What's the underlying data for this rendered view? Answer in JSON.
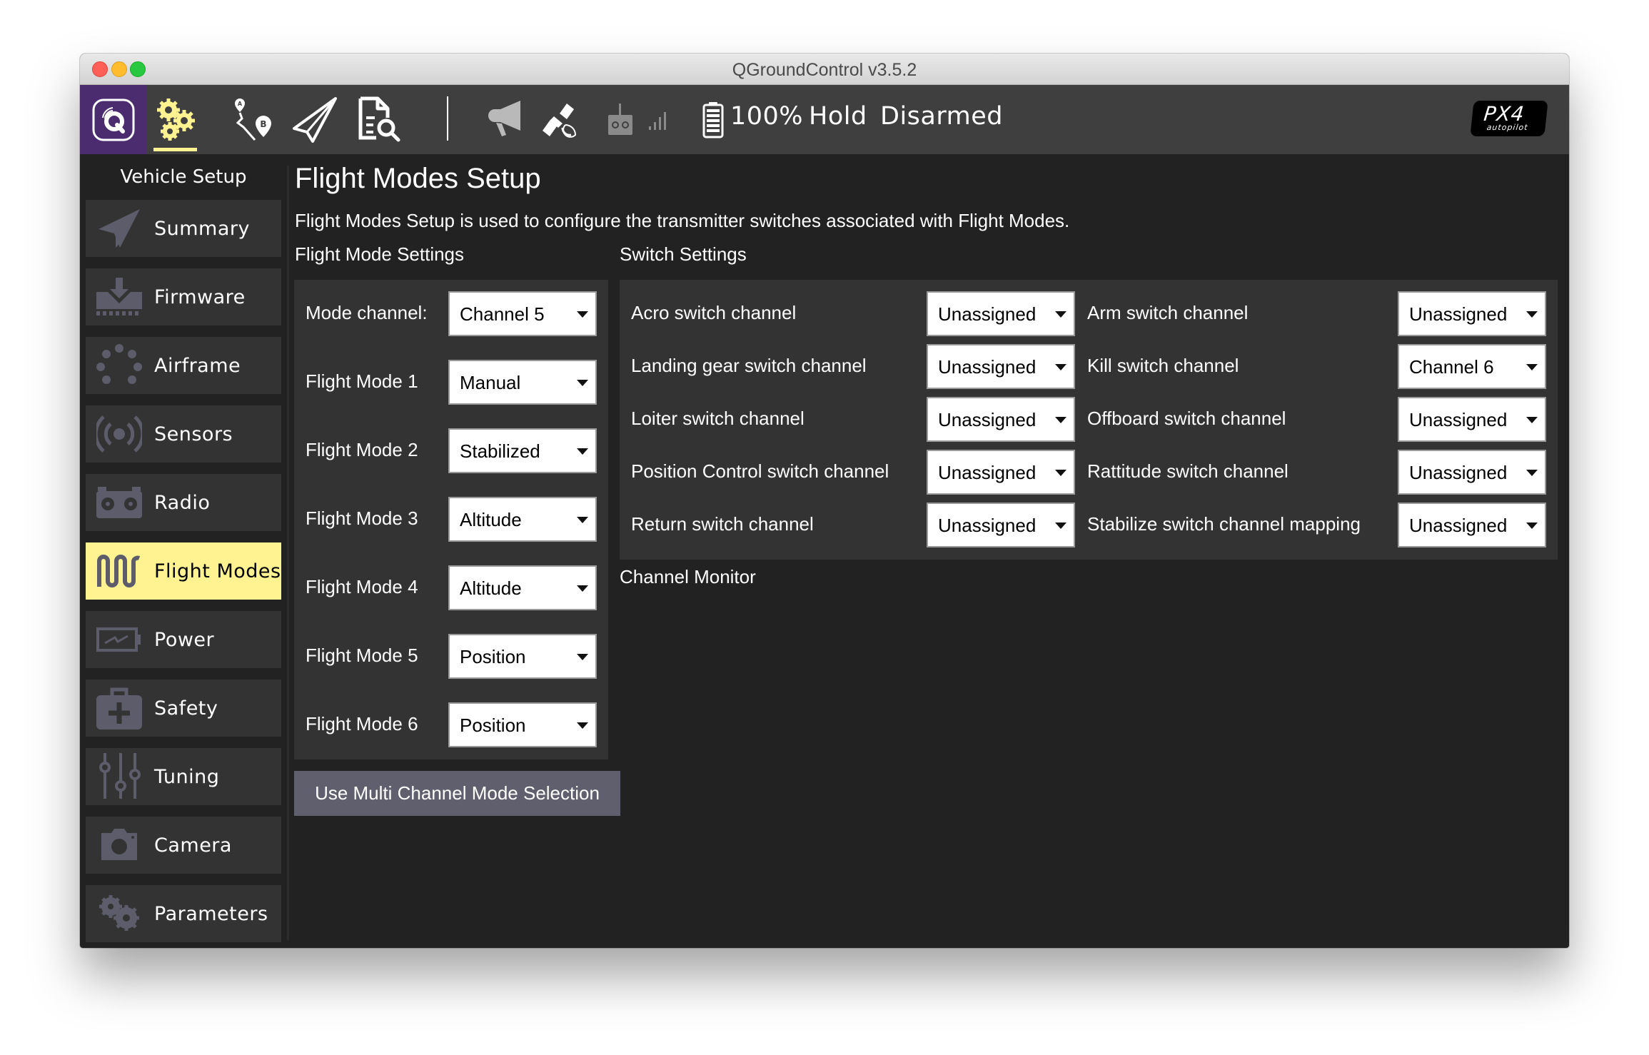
{
  "window": {
    "title": "QGroundControl v3.5.2"
  },
  "toolbar": {
    "icons": [
      {
        "name": "qgc-logo-icon"
      },
      {
        "name": "vehicle-setup-gears-icon"
      },
      {
        "name": "plan-view-route-icon"
      },
      {
        "name": "fly-view-paper-plane-icon"
      },
      {
        "name": "analyze-document-search-icon"
      },
      {
        "name": "megaphone-messages-icon"
      },
      {
        "name": "gps-satellite-icon"
      },
      {
        "name": "rc-transmitter-icon"
      },
      {
        "name": "rc-signal-strength-icon"
      },
      {
        "name": "battery-icon"
      }
    ],
    "battery_percent": "100%",
    "flight_mode": "Hold",
    "arm_status": "Disarmed",
    "brand_logo_text": "PX4",
    "brand_logo_sub": "autopilot",
    "accent_color": "#fff291",
    "logo_bg_color": "#4a2c6f"
  },
  "sidebar": {
    "title": "Vehicle Setup",
    "active_item": "Flight Modes",
    "items": [
      {
        "label": "Summary",
        "icon": "paper-plane-icon"
      },
      {
        "label": "Firmware",
        "icon": "firmware-download-icon"
      },
      {
        "label": "Airframe",
        "icon": "airframe-dots-icon"
      },
      {
        "label": "Sensors",
        "icon": "sensors-radio-waves-icon"
      },
      {
        "label": "Radio",
        "icon": "radio-transmitter-icon"
      },
      {
        "label": "Flight Modes",
        "icon": "flight-modes-wave-icon"
      },
      {
        "label": "Power",
        "icon": "power-battery-icon"
      },
      {
        "label": "Safety",
        "icon": "safety-first-aid-icon"
      },
      {
        "label": "Tuning",
        "icon": "tuning-sliders-icon"
      },
      {
        "label": "Camera",
        "icon": "camera-icon"
      },
      {
        "label": "Parameters",
        "icon": "parameters-gears-icon"
      }
    ]
  },
  "main": {
    "title": "Flight Modes Setup",
    "description": "Flight Modes Setup is used to configure the transmitter switches associated with Flight Modes.",
    "flight_mode_settings": {
      "heading": "Flight Mode Settings",
      "mode_channel_label": "Mode channel:",
      "mode_channel_value": "Channel 5",
      "modes": [
        {
          "label": "Flight Mode 1",
          "value": "Manual"
        },
        {
          "label": "Flight Mode 2",
          "value": "Stabilized"
        },
        {
          "label": "Flight Mode 3",
          "value": "Altitude"
        },
        {
          "label": "Flight Mode 4",
          "value": "Altitude"
        },
        {
          "label": "Flight Mode 5",
          "value": "Position"
        },
        {
          "label": "Flight Mode 6",
          "value": "Position"
        }
      ],
      "multi_channel_button": "Use Multi Channel Mode Selection"
    },
    "switch_settings": {
      "heading": "Switch Settings",
      "left_column": [
        {
          "label": "Acro switch channel",
          "value": "Unassigned"
        },
        {
          "label": "Landing gear switch channel",
          "value": "Unassigned"
        },
        {
          "label": "Loiter switch channel",
          "value": "Unassigned"
        },
        {
          "label": "Position Control switch channel",
          "value": "Unassigned"
        },
        {
          "label": "Return switch channel",
          "value": "Unassigned"
        }
      ],
      "right_column": [
        {
          "label": "Arm switch channel",
          "value": "Unassigned"
        },
        {
          "label": "Kill switch channel",
          "value": "Channel 6"
        },
        {
          "label": "Offboard switch channel",
          "value": "Unassigned"
        },
        {
          "label": "Rattitude switch channel",
          "value": "Unassigned"
        },
        {
          "label": "Stabilize switch channel mapping",
          "value": "Unassigned"
        }
      ]
    },
    "channel_monitor": {
      "heading": "Channel Monitor"
    }
  }
}
